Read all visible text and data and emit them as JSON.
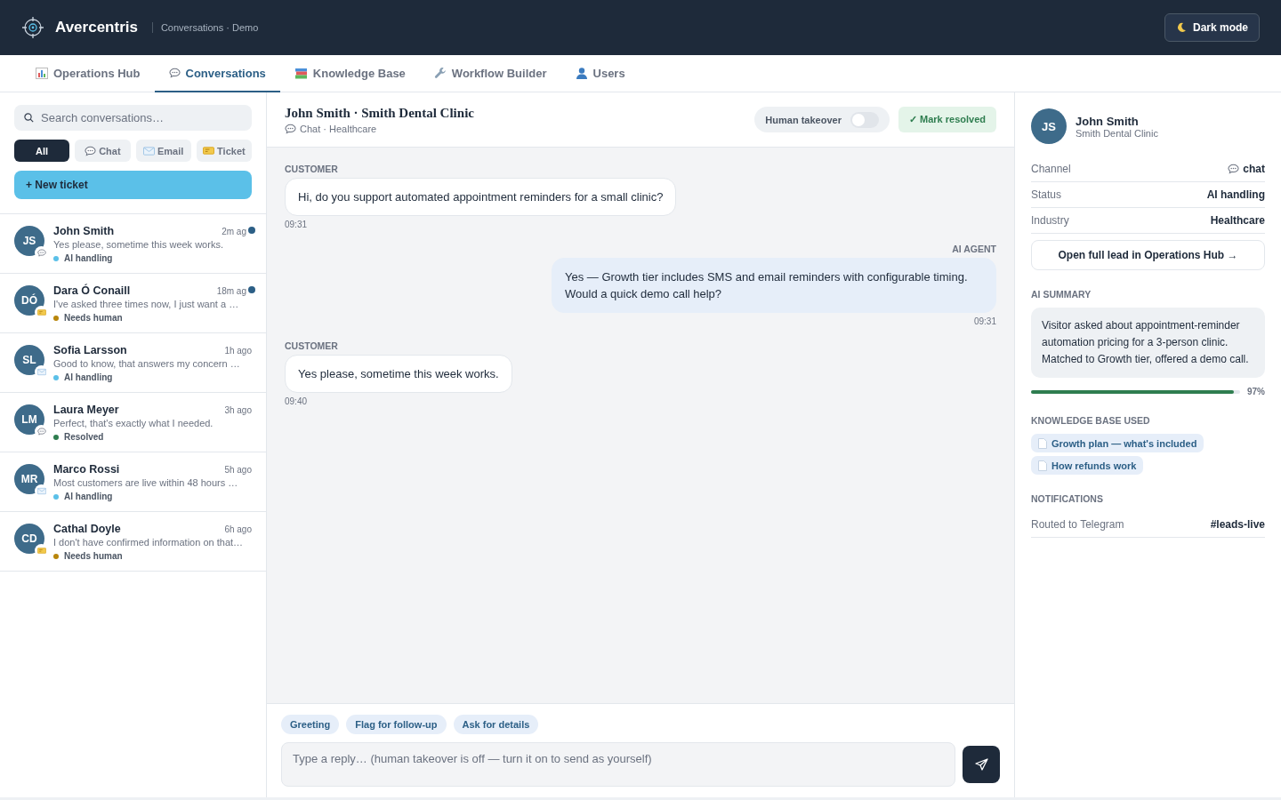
{
  "header": {
    "brand": "Avercentris",
    "subtitle": "Conversations · Demo",
    "theme_button": "Dark mode"
  },
  "tabs": [
    {
      "label": "Operations Hub",
      "kind": "chart",
      "selected": false
    },
    {
      "label": "Conversations",
      "kind": "chat",
      "selected": true
    },
    {
      "label": "Knowledge Base",
      "kind": "books",
      "selected": false
    },
    {
      "label": "Workflow Builder",
      "kind": "wrench",
      "selected": false
    },
    {
      "label": "Users",
      "kind": "user",
      "selected": false
    }
  ],
  "sidebar": {
    "search": {
      "placeholder": "Search conversations…"
    },
    "filters": [
      {
        "label": "All",
        "kind": "all",
        "selected": true
      },
      {
        "label": "Chat",
        "kind": "chat",
        "selected": false
      },
      {
        "label": "Email",
        "kind": "email",
        "selected": false
      },
      {
        "label": "Ticket",
        "kind": "ticket",
        "selected": false
      }
    ],
    "new_button": "+ New ticket",
    "conversations": [
      {
        "initials": "JS",
        "name": "John Smith",
        "time": "2m ag",
        "preview": "Yes please, sometime this week works.",
        "status": "AI handling",
        "color": "#5bc0e8",
        "kind": "chat",
        "unread": true
      },
      {
        "initials": "DÓ",
        "name": "Dara Ó Conaill",
        "time": "18m ag",
        "preview": "I've asked three times now, I just want a …",
        "status": "Needs human",
        "color": "#b8860b",
        "kind": "ticket",
        "unread": true
      },
      {
        "initials": "SL",
        "name": "Sofia Larsson",
        "time": "1h ago",
        "preview": "Good to know, that answers my concern …",
        "status": "AI handling",
        "color": "#5bc0e8",
        "kind": "email",
        "unread": false
      },
      {
        "initials": "LM",
        "name": "Laura Meyer",
        "time": "3h ago",
        "preview": "Perfect, that's exactly what I needed.",
        "status": "Resolved",
        "color": "#2e7d4f",
        "kind": "chat",
        "unread": false
      },
      {
        "initials": "MR",
        "name": "Marco Rossi",
        "time": "5h ago",
        "preview": "Most customers are live within 48 hours …",
        "status": "AI handling",
        "color": "#5bc0e8",
        "kind": "email",
        "unread": false
      },
      {
        "initials": "CD",
        "name": "Cathal Doyle",
        "time": "6h ago",
        "preview": "I don't have confirmed information on that…",
        "status": "Needs human",
        "color": "#b8860b",
        "kind": "ticket",
        "unread": false
      }
    ]
  },
  "chat": {
    "title": "John Smith · Smith Dental Clinic",
    "kind": "chat",
    "subtitle": "Chat · Healthcare",
    "human_takeover": {
      "label": "Human takeover",
      "on": false
    },
    "resolve_button": "✓ Mark resolved",
    "messages": [
      {
        "kind": "customer",
        "sender": "CUSTOMER",
        "text": "Hi, do you support automated appointment reminders for a small clinic?",
        "time": "09:31"
      },
      {
        "kind": "agent",
        "sender": "AI AGENT",
        "text": "Yes — Growth tier includes SMS and email reminders with configurable timing. Would a quick demo call help?",
        "time": "09:31"
      },
      {
        "kind": "customer",
        "sender": "CUSTOMER",
        "text": "Yes please, sometime this week works.",
        "time": "09:40"
      }
    ],
    "quick_replies": [
      "Greeting",
      "Flag for follow-up",
      "Ask for details"
    ],
    "composer": {
      "placeholder": "Type a reply… (human takeover is off — turn it on to send as yourself)"
    }
  },
  "lead": {
    "initials": "JS",
    "name": "John Smith",
    "company": "Smith Dental Clinic",
    "details": [
      {
        "label": "Channel",
        "value": "chat",
        "kind": "channel"
      },
      {
        "label": "Status",
        "value": "AI handling",
        "kind": "text"
      },
      {
        "label": "Industry",
        "value": "Healthcare",
        "kind": "text"
      }
    ],
    "open_button": "Open full lead in Operations Hub →",
    "summary_heading": "AI SUMMARY",
    "summary": "Visitor asked about appointment-reminder automation pricing for a 3-person clinic. Matched to Growth tier, offered a demo call.",
    "confidence": {
      "level": 0.97,
      "reading": "97%"
    },
    "kb_heading": "KNOWLEDGE BASE USED",
    "kb_articles": [
      "Growth plan — what's included",
      "How refunds work"
    ],
    "notifications_heading": "NOTIFICATIONS",
    "notifications": [
      {
        "label": "Routed to Telegram",
        "value": "#leads-live"
      }
    ]
  }
}
